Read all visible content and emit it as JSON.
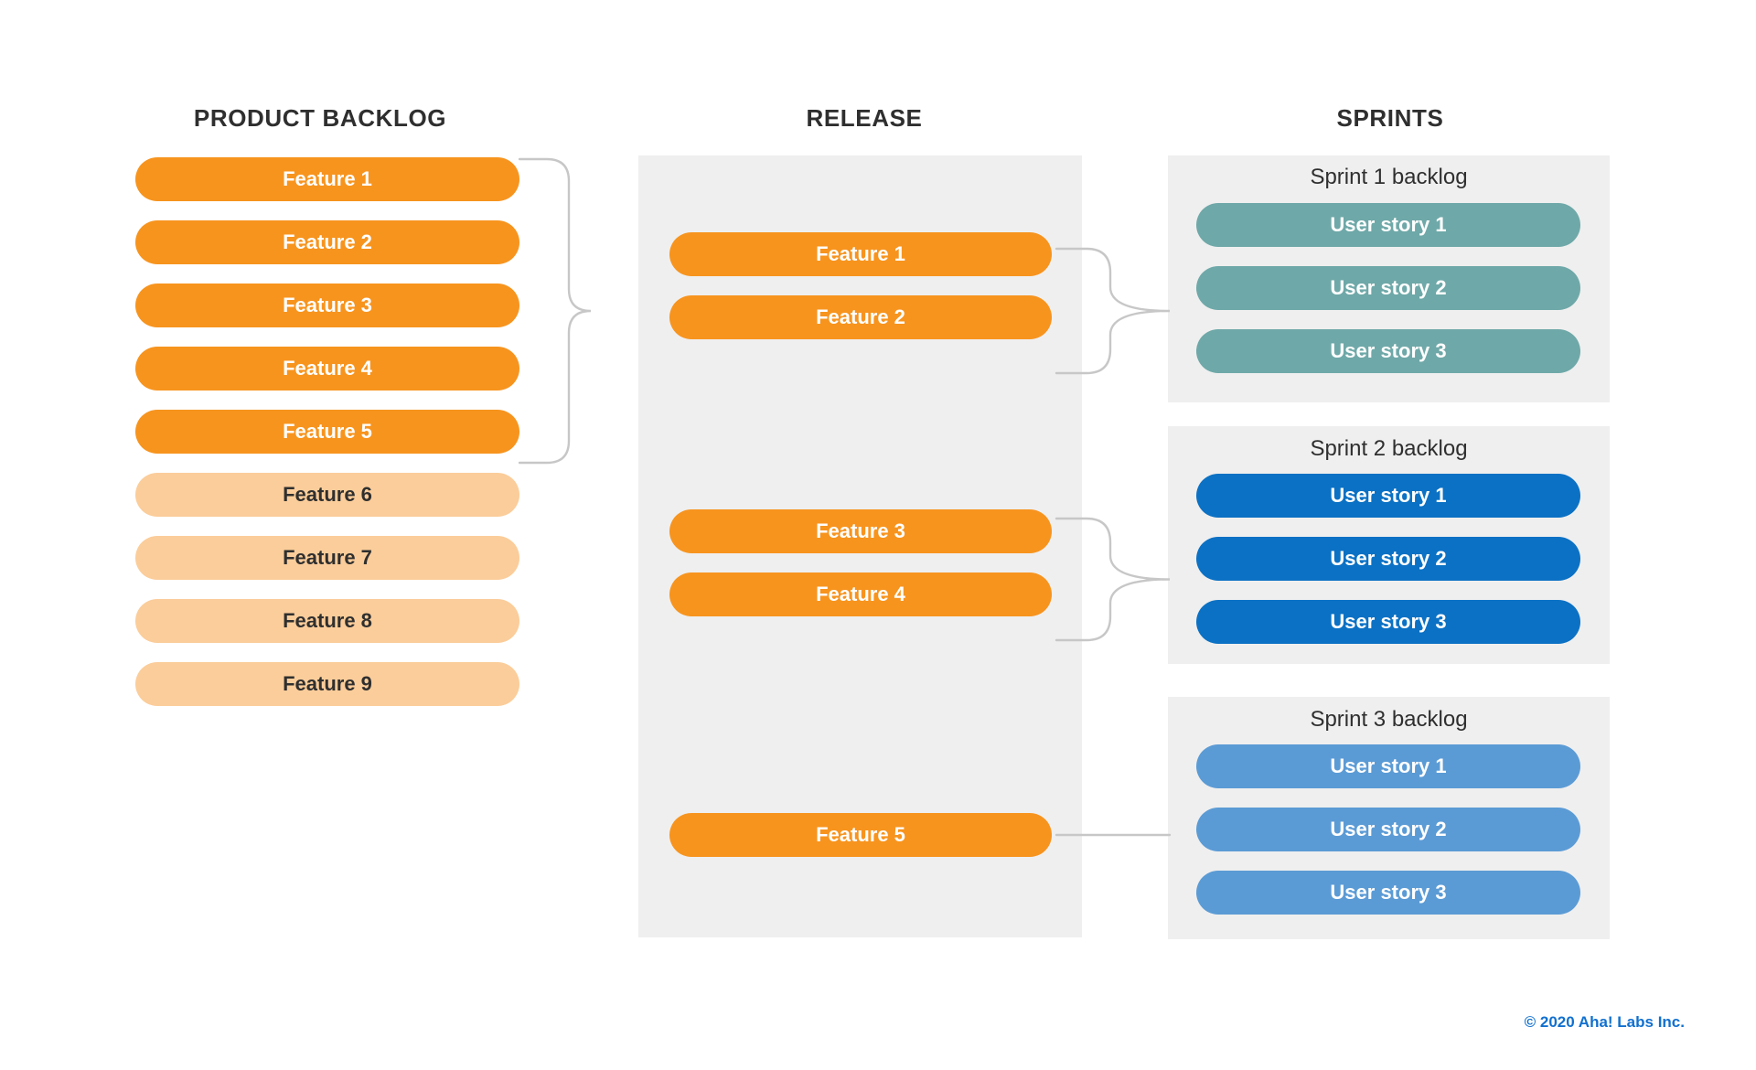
{
  "columns": {
    "backlog_title": "PRODUCT BACKLOG",
    "release_title": "RELEASE",
    "sprints_title": "SPRINTS"
  },
  "colors": {
    "feature_active": "#f7941e",
    "feature_inactive": "#fbcd9a",
    "panel_background": "#efefef",
    "sprint1_story": "#6fa8a8",
    "sprint2_story": "#0b71c4",
    "sprint3_story": "#5b9bd5",
    "connector_line": "#c7c7c7",
    "heading_text": "#2f2f2f",
    "copyright_text": "#1170cf"
  },
  "product_backlog": {
    "items": [
      {
        "label": "Feature 1",
        "state": "active"
      },
      {
        "label": "Feature 2",
        "state": "active"
      },
      {
        "label": "Feature 3",
        "state": "active"
      },
      {
        "label": "Feature 4",
        "state": "active"
      },
      {
        "label": "Feature 5",
        "state": "active"
      },
      {
        "label": "Feature 6",
        "state": "inactive"
      },
      {
        "label": "Feature 7",
        "state": "inactive"
      },
      {
        "label": "Feature 8",
        "state": "inactive"
      },
      {
        "label": "Feature 9",
        "state": "inactive"
      }
    ]
  },
  "release": {
    "groups": [
      {
        "items": [
          {
            "label": "Feature 1"
          },
          {
            "label": "Feature 2"
          }
        ]
      },
      {
        "items": [
          {
            "label": "Feature 3"
          },
          {
            "label": "Feature 4"
          }
        ]
      },
      {
        "items": [
          {
            "label": "Feature 5"
          }
        ]
      }
    ]
  },
  "sprints": [
    {
      "heading": "Sprint 1 backlog",
      "color": "#6fa8a8",
      "stories": [
        {
          "label": "User story 1"
        },
        {
          "label": "User story 2"
        },
        {
          "label": "User story 3"
        }
      ]
    },
    {
      "heading": "Sprint 2 backlog",
      "color": "#0b71c4",
      "stories": [
        {
          "label": "User story 1"
        },
        {
          "label": "User story 2"
        },
        {
          "label": "User story 3"
        }
      ]
    },
    {
      "heading": "Sprint 3 backlog",
      "color": "#5b9bd5",
      "stories": [
        {
          "label": "User story 1"
        },
        {
          "label": "User story 2"
        },
        {
          "label": "User story 3"
        }
      ]
    }
  ],
  "footer": {
    "copyright": "© 2020 Aha! Labs Inc."
  }
}
